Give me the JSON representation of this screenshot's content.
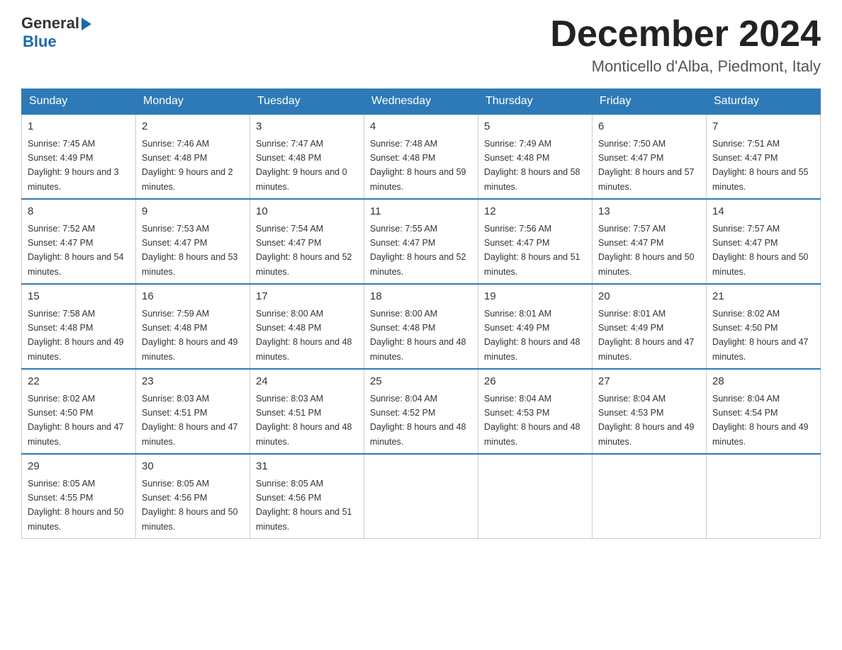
{
  "header": {
    "logo_general": "General",
    "logo_blue": "Blue",
    "month_title": "December 2024",
    "location": "Monticello d'Alba, Piedmont, Italy"
  },
  "days_of_week": [
    "Sunday",
    "Monday",
    "Tuesday",
    "Wednesday",
    "Thursday",
    "Friday",
    "Saturday"
  ],
  "weeks": [
    [
      {
        "day": 1,
        "sunrise": "7:45 AM",
        "sunset": "4:49 PM",
        "daylight": "9 hours and 3 minutes."
      },
      {
        "day": 2,
        "sunrise": "7:46 AM",
        "sunset": "4:48 PM",
        "daylight": "9 hours and 2 minutes."
      },
      {
        "day": 3,
        "sunrise": "7:47 AM",
        "sunset": "4:48 PM",
        "daylight": "9 hours and 0 minutes."
      },
      {
        "day": 4,
        "sunrise": "7:48 AM",
        "sunset": "4:48 PM",
        "daylight": "8 hours and 59 minutes."
      },
      {
        "day": 5,
        "sunrise": "7:49 AM",
        "sunset": "4:48 PM",
        "daylight": "8 hours and 58 minutes."
      },
      {
        "day": 6,
        "sunrise": "7:50 AM",
        "sunset": "4:47 PM",
        "daylight": "8 hours and 57 minutes."
      },
      {
        "day": 7,
        "sunrise": "7:51 AM",
        "sunset": "4:47 PM",
        "daylight": "8 hours and 55 minutes."
      }
    ],
    [
      {
        "day": 8,
        "sunrise": "7:52 AM",
        "sunset": "4:47 PM",
        "daylight": "8 hours and 54 minutes."
      },
      {
        "day": 9,
        "sunrise": "7:53 AM",
        "sunset": "4:47 PM",
        "daylight": "8 hours and 53 minutes."
      },
      {
        "day": 10,
        "sunrise": "7:54 AM",
        "sunset": "4:47 PM",
        "daylight": "8 hours and 52 minutes."
      },
      {
        "day": 11,
        "sunrise": "7:55 AM",
        "sunset": "4:47 PM",
        "daylight": "8 hours and 52 minutes."
      },
      {
        "day": 12,
        "sunrise": "7:56 AM",
        "sunset": "4:47 PM",
        "daylight": "8 hours and 51 minutes."
      },
      {
        "day": 13,
        "sunrise": "7:57 AM",
        "sunset": "4:47 PM",
        "daylight": "8 hours and 50 minutes."
      },
      {
        "day": 14,
        "sunrise": "7:57 AM",
        "sunset": "4:47 PM",
        "daylight": "8 hours and 50 minutes."
      }
    ],
    [
      {
        "day": 15,
        "sunrise": "7:58 AM",
        "sunset": "4:48 PM",
        "daylight": "8 hours and 49 minutes."
      },
      {
        "day": 16,
        "sunrise": "7:59 AM",
        "sunset": "4:48 PM",
        "daylight": "8 hours and 49 minutes."
      },
      {
        "day": 17,
        "sunrise": "8:00 AM",
        "sunset": "4:48 PM",
        "daylight": "8 hours and 48 minutes."
      },
      {
        "day": 18,
        "sunrise": "8:00 AM",
        "sunset": "4:48 PM",
        "daylight": "8 hours and 48 minutes."
      },
      {
        "day": 19,
        "sunrise": "8:01 AM",
        "sunset": "4:49 PM",
        "daylight": "8 hours and 48 minutes."
      },
      {
        "day": 20,
        "sunrise": "8:01 AM",
        "sunset": "4:49 PM",
        "daylight": "8 hours and 47 minutes."
      },
      {
        "day": 21,
        "sunrise": "8:02 AM",
        "sunset": "4:50 PM",
        "daylight": "8 hours and 47 minutes."
      }
    ],
    [
      {
        "day": 22,
        "sunrise": "8:02 AM",
        "sunset": "4:50 PM",
        "daylight": "8 hours and 47 minutes."
      },
      {
        "day": 23,
        "sunrise": "8:03 AM",
        "sunset": "4:51 PM",
        "daylight": "8 hours and 47 minutes."
      },
      {
        "day": 24,
        "sunrise": "8:03 AM",
        "sunset": "4:51 PM",
        "daylight": "8 hours and 48 minutes."
      },
      {
        "day": 25,
        "sunrise": "8:04 AM",
        "sunset": "4:52 PM",
        "daylight": "8 hours and 48 minutes."
      },
      {
        "day": 26,
        "sunrise": "8:04 AM",
        "sunset": "4:53 PM",
        "daylight": "8 hours and 48 minutes."
      },
      {
        "day": 27,
        "sunrise": "8:04 AM",
        "sunset": "4:53 PM",
        "daylight": "8 hours and 49 minutes."
      },
      {
        "day": 28,
        "sunrise": "8:04 AM",
        "sunset": "4:54 PM",
        "daylight": "8 hours and 49 minutes."
      }
    ],
    [
      {
        "day": 29,
        "sunrise": "8:05 AM",
        "sunset": "4:55 PM",
        "daylight": "8 hours and 50 minutes."
      },
      {
        "day": 30,
        "sunrise": "8:05 AM",
        "sunset": "4:56 PM",
        "daylight": "8 hours and 50 minutes."
      },
      {
        "day": 31,
        "sunrise": "8:05 AM",
        "sunset": "4:56 PM",
        "daylight": "8 hours and 51 minutes."
      },
      null,
      null,
      null,
      null
    ]
  ]
}
